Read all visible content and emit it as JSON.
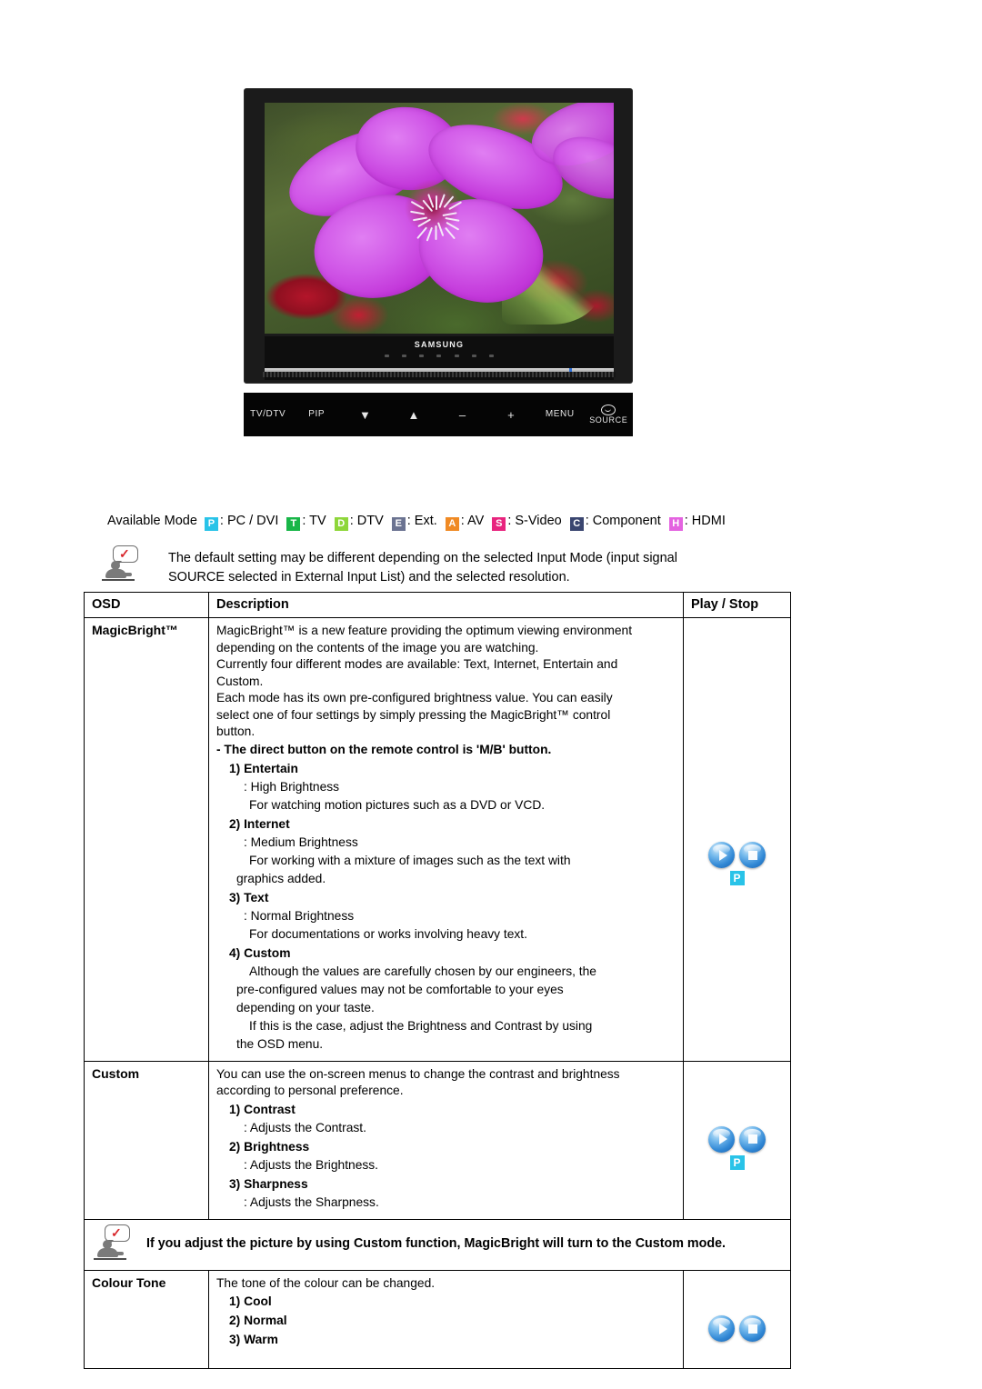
{
  "figure": {
    "name": "samsung-monitor-illustration",
    "brand": "SAMSUNG",
    "screen_content": "purple flower photograph",
    "controls": [
      {
        "name": "tv-dtv",
        "label": "TV/DTV"
      },
      {
        "name": "pip",
        "label": "PIP"
      },
      {
        "name": "down",
        "label": "▼"
      },
      {
        "name": "up",
        "label": "▲"
      },
      {
        "name": "minus",
        "label": "–"
      },
      {
        "name": "plus",
        "label": "+"
      },
      {
        "name": "menu",
        "label": "MENU"
      },
      {
        "name": "source",
        "label": "SOURCE"
      }
    ]
  },
  "available_mode": {
    "label": "Available Mode",
    "items": [
      {
        "badge": "P",
        "text": ": PC / DVI",
        "color": "#29c3e8"
      },
      {
        "badge": "T",
        "text": ": TV",
        "color": "#18b648"
      },
      {
        "badge": "D",
        "text": ": DTV",
        "color": "#8ed63a"
      },
      {
        "badge": "E",
        "text": ": Ext.",
        "color": "#6b7391"
      },
      {
        "badge": "A",
        "text": ": AV",
        "color": "#f08a24"
      },
      {
        "badge": "S",
        "text": ": S-Video",
        "color": "#e8247e"
      },
      {
        "badge": "C",
        "text": ": Component",
        "color": "#3a4670"
      },
      {
        "badge": "H",
        "text": ": HDMI",
        "color": "#e463e0"
      }
    ]
  },
  "top_note": {
    "icon": "note-person-check-icon",
    "line1": "The default setting may be different depending on the selected Input Mode (input signal",
    "line2": "SOURCE selected in External Input List) and the selected resolution."
  },
  "table": {
    "headers": {
      "osd": "OSD",
      "description": "Description",
      "play_stop": "Play / Stop"
    },
    "rows": {
      "magicbright": {
        "osd": "MagicBright™",
        "paragraphs": [
          "MagicBright™ is a new feature providing the optimum viewing environment",
          "depending on the contents of the image you are watching.",
          "Currently four different modes are available: Text, Internet, Entertain and",
          "Custom.",
          "Each mode has its own pre-configured brightness value. You can easily",
          "select one of four settings by simply pressing the MagicBright™ control",
          "button."
        ],
        "remote_note": "- The direct button on the remote control is 'M/B' button.",
        "modes": [
          {
            "title": "1) Entertain",
            "brightness": ": High Brightness",
            "detail": [
              "For watching motion pictures such as a DVD or VCD."
            ]
          },
          {
            "title": "2) Internet",
            "brightness": ": Medium Brightness",
            "detail": [
              "For working with a mixture of images such as the text with",
              "graphics added."
            ]
          },
          {
            "title": "3) Text",
            "brightness": ": Normal Brightness",
            "detail": [
              "For documentations or works involving heavy text."
            ]
          },
          {
            "title": "4) Custom",
            "brightness": "",
            "detail": [
              "Although the values are carefully chosen by our engineers, the",
              "pre-configured values may not be comfortable to your eyes",
              "depending on your taste.",
              "If this is the case, adjust the Brightness and Contrast by using",
              "the OSD menu."
            ]
          }
        ],
        "play_badge": "P",
        "play_badge_color": "#29c3e8"
      },
      "custom": {
        "osd": "Custom",
        "paragraphs": [
          "You can use the on-screen menus to change the contrast and brightness",
          "according to personal preference."
        ],
        "items": [
          {
            "title": "1) Contrast",
            "desc": ": Adjusts the Contrast."
          },
          {
            "title": "2) Brightness",
            "desc": ": Adjusts the Brightness."
          },
          {
            "title": "3) Sharpness",
            "desc": ": Adjusts the Sharpness."
          }
        ],
        "play_badge": "P",
        "play_badge_color": "#29c3e8"
      },
      "inline_note": {
        "icon": "note-person-check-icon",
        "text": "If you adjust the picture by using Custom function, MagicBright will turn to the Custom mode."
      },
      "colour_tone": {
        "osd": "Colour Tone",
        "paragraphs": [
          "The tone of the colour can be changed."
        ],
        "items": [
          {
            "title": "1) Cool"
          },
          {
            "title": "2) Normal"
          },
          {
            "title": "3) Warm"
          }
        ]
      }
    }
  }
}
